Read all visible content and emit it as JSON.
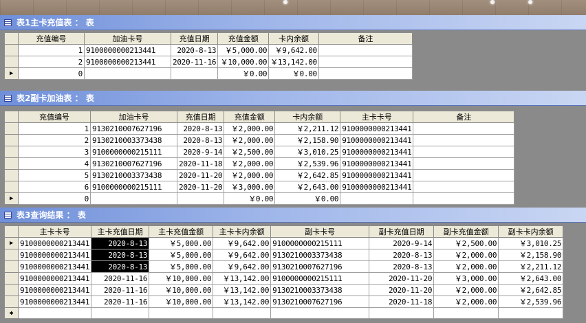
{
  "window1": {
    "title": "表1主卡充值表 ： 表",
    "columns": [
      "充值编号",
      "加油卡号",
      "充值日期",
      "充值金额",
      "卡内余额",
      "备注"
    ],
    "rows": [
      [
        "1",
        "9100000000213441",
        "2020-8-13",
        "￥5,000.00",
        "￥9,642.00",
        ""
      ],
      [
        "2",
        "9100000000213441",
        "2020-11-16",
        "￥10,000.00",
        "￥13,142.00",
        ""
      ]
    ],
    "new_row": [
      "0",
      "",
      "",
      "￥0.00",
      "￥0.00",
      ""
    ],
    "new_marker": "▶"
  },
  "window2": {
    "title": "表2副卡加油表 ： 表",
    "columns": [
      "充值编号",
      "加油卡号",
      "充值日期",
      "充值金额",
      "卡内余额",
      "主卡卡号",
      "备注"
    ],
    "rows": [
      [
        "1",
        "9130210007627196",
        "2020-8-13",
        "￥2,000.00",
        "￥2,211.12",
        "9100000000213441",
        ""
      ],
      [
        "2",
        "9130210003373438",
        "2020-8-13",
        "￥2,000.00",
        "￥2,158.90",
        "9100000000213441",
        ""
      ],
      [
        "3",
        "9100000000215111",
        "2020-9-14",
        "￥2,500.00",
        "￥3,010.25",
        "9100000000213441",
        ""
      ],
      [
        "4",
        "9130210007627196",
        "2020-11-18",
        "￥2,000.00",
        "￥2,539.96",
        "9100000000213441",
        ""
      ],
      [
        "5",
        "9130210003373438",
        "2020-11-20",
        "￥2,000.00",
        "￥2,642.85",
        "9100000000213441",
        ""
      ],
      [
        "6",
        "9100000000215111",
        "2020-11-20",
        "￥3,000.00",
        "￥2,643.00",
        "9100000000213441",
        ""
      ]
    ],
    "new_row": [
      "0",
      "",
      "",
      "￥0.00",
      "￥0.00",
      "",
      ""
    ],
    "new_marker": "▶"
  },
  "window3": {
    "title": "表3查询结果 ： 表",
    "columns": [
      "主卡卡号",
      "主卡充值日期",
      "主卡充值金额",
      "主卡卡内余额",
      "副卡卡号",
      "副卡充值日期",
      "副卡充值金额",
      "副卡卡内余额"
    ],
    "rows": [
      [
        "9100000000213441",
        "2020-8-13",
        "￥5,000.00",
        "￥9,642.00",
        "9100000000215111",
        "2020-9-14",
        "￥2,500.00",
        "￥3,010.25"
      ],
      [
        "9100000000213441",
        "2020-8-13",
        "￥5,000.00",
        "￥9,642.00",
        "9130210003373438",
        "2020-8-13",
        "￥2,000.00",
        "￥2,158.90"
      ],
      [
        "9100000000213441",
        "2020-8-13",
        "￥5,000.00",
        "￥9,642.00",
        "9130210007627196",
        "2020-8-13",
        "￥2,000.00",
        "￥2,211.12"
      ],
      [
        "9100000000213441",
        "2020-11-16",
        "￥10,000.00",
        "￥13,142.00",
        "9100000000215111",
        "2020-11-20",
        "￥3,000.00",
        "￥2,643.00"
      ],
      [
        "9100000000213441",
        "2020-11-16",
        "￥10,000.00",
        "￥13,142.00",
        "9130210003373438",
        "2020-11-20",
        "￥2,000.00",
        "￥2,642.85"
      ],
      [
        "9100000000213441",
        "2020-11-16",
        "￥10,000.00",
        "￥13,142.00",
        "9130210007627196",
        "2020-11-18",
        "￥2,000.00",
        "￥2,539.96"
      ]
    ],
    "current_marker": "▶",
    "new_marker": "✱"
  },
  "colors": {
    "highlight": "#000000",
    "titlebar": "#6f8fd9"
  }
}
